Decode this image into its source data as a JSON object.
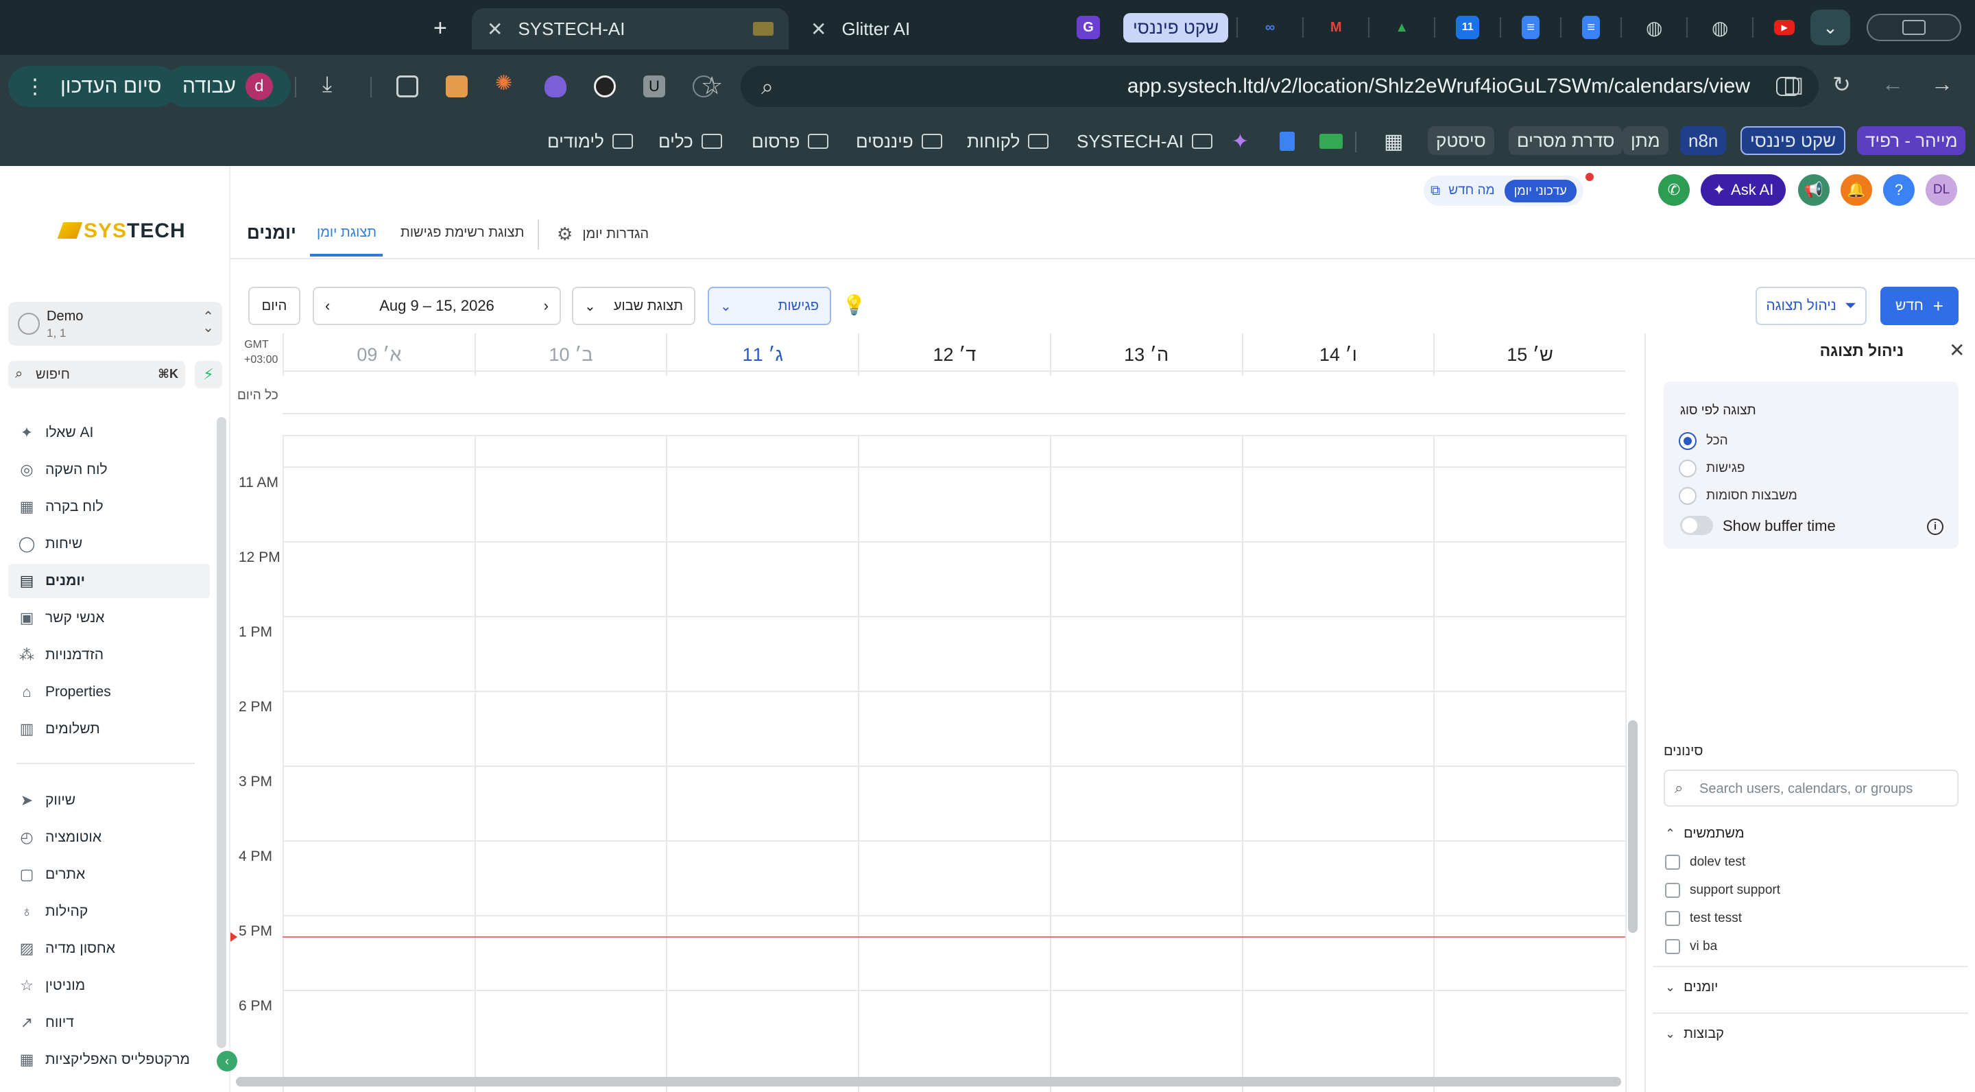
{
  "browser": {
    "tabs": [
      {
        "title": "SYSTECH-AI",
        "active": true
      },
      {
        "title": "Glitter AI",
        "active": false
      }
    ],
    "pinned_pill": "שקט פיננסי",
    "url": "app.systech.ltd/v2/location/Shlz2eWruf4ioGuL7SWm/calendars/view",
    "finish_update": "סיום העדכון",
    "account_label": "עבודה",
    "account_initial": "d",
    "bookmarks_pills": [
      "מייהר - רפיד",
      "שקט פיננסי",
      "n8n",
      "מתן",
      "סדרת מסרים",
      "סיסטק"
    ],
    "bookmark_folders": [
      "SYSTECH-AI",
      "לקוחות",
      "פיננסים",
      "פרסום",
      "כלים",
      "לימודים"
    ]
  },
  "sidebar": {
    "logo_sys": "SYS",
    "logo_tech": "TECH",
    "location": {
      "name": "Demo",
      "sub": "1, 1"
    },
    "search_placeholder": "חיפוש",
    "search_kbd": "⌘K",
    "items": [
      {
        "label": "שאלו AI",
        "icon": "sparkle-icon"
      },
      {
        "label": "לוח השקה",
        "icon": "rocket-icon"
      },
      {
        "label": "לוח בקרה",
        "icon": "dashboard-icon"
      },
      {
        "label": "שיחות",
        "icon": "chat-icon"
      },
      {
        "label": "יומנים",
        "icon": "calendar-icon",
        "active": true
      },
      {
        "label": "אנשי קשר",
        "icon": "contacts-icon"
      },
      {
        "label": "הזדמנויות",
        "icon": "opportunities-icon"
      },
      {
        "label": "Properties",
        "icon": "home-icon"
      },
      {
        "label": "תשלומים",
        "icon": "payments-icon"
      },
      {
        "label": "שיווק",
        "icon": "send-icon"
      },
      {
        "label": "אוטומציה",
        "icon": "automation-icon"
      },
      {
        "label": "אתרים",
        "icon": "sites-icon"
      },
      {
        "label": "קהילות",
        "icon": "community-icon"
      },
      {
        "label": "אחסון מדיה",
        "icon": "media-icon"
      },
      {
        "label": "מוניטין",
        "icon": "star-icon"
      },
      {
        "label": "דיווח",
        "icon": "report-icon"
      },
      {
        "label": "מרקטפלייס האפליקציות",
        "icon": "apps-icon"
      }
    ]
  },
  "header": {
    "title": "יומנים",
    "tabs": [
      {
        "label": "תצוגת יומן",
        "active": true
      },
      {
        "label": "תצוגת רשימת פגישות",
        "active": false
      }
    ],
    "settings_label": "הגדרות יומן",
    "whats_new": "מה חדש",
    "whats_new_badge": "עדכוני יומן",
    "ask_ai": "Ask AI",
    "user_initials": "DL"
  },
  "toolbar": {
    "new_label": "חדש",
    "manage_view_label": "ניהול תצוגה",
    "meetings_select": "פגישות",
    "week_select": "תצוגת שבוע",
    "date_range": "Aug 9 – 15, 2026",
    "today_label": "היום"
  },
  "calendar": {
    "timezone": "GMT +03:00",
    "all_day_label": "כל היום",
    "days": [
      {
        "label": "09 א׳",
        "state": "past"
      },
      {
        "label": "10 ב׳",
        "state": "past"
      },
      {
        "label": "11 ג׳",
        "state": "today"
      },
      {
        "label": "12 ד׳",
        "state": "future"
      },
      {
        "label": "13 ה׳",
        "state": "future"
      },
      {
        "label": "14 ו׳",
        "state": "future"
      },
      {
        "label": "15 ש׳",
        "state": "future"
      }
    ],
    "hours": [
      "11 AM",
      "12 PM",
      "1 PM",
      "2 PM",
      "3 PM",
      "4 PM",
      "5 PM",
      "6 PM"
    ],
    "now_marker_after_hour": "5 PM",
    "now_fraction_of_hour": 0.28
  },
  "panel": {
    "title": "ניהול תצוגה",
    "by_type_label": "תצוגה לפי סוג",
    "type_options": [
      {
        "label": "הכל",
        "selected": true
      },
      {
        "label": "פגישות",
        "selected": false
      },
      {
        "label": "משבצות חסומות",
        "selected": false
      }
    ],
    "buffer_label": "Show buffer time",
    "filters_label": "סינונים",
    "search_placeholder": "Search users, calendars, or groups",
    "users_header": "משתמשים",
    "users": [
      "dolev test",
      "support support",
      "test tesst",
      "vi ba"
    ],
    "calendars_header": "יומנים",
    "groups_header": "קבוצות"
  },
  "colors": {
    "primary": "#2f6ee6",
    "today": "#2a58c9",
    "now_line": "#e57373",
    "ask_ai": "#3b1fa8"
  }
}
